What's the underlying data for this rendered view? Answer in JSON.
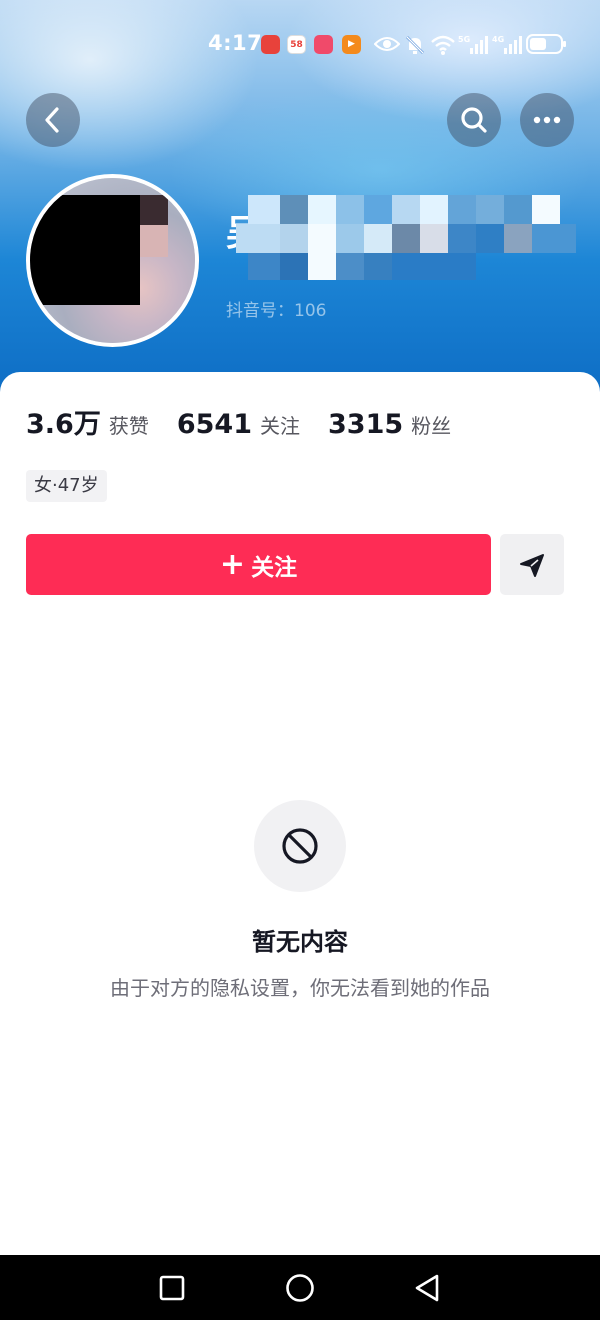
{
  "status_bar": {
    "time": "4:17",
    "app_badges": [
      {
        "name": "app-red",
        "text": "",
        "color": "#e8423b"
      },
      {
        "name": "app-58",
        "text": "58",
        "color": "#f3a21b"
      },
      {
        "name": "app-pink",
        "text": "",
        "color": "#f04a6a"
      },
      {
        "name": "app-play",
        "text": "",
        "color": "#f48a1c"
      }
    ],
    "network": "5G 4G",
    "battery_level": 0.55
  },
  "header": {
    "back_icon": "chevron-left-icon",
    "search_icon": "search-icon",
    "more_icon": "more-horizontal-icon",
    "nickname_partial": "吴",
    "id_label": "抖音号：106"
  },
  "stats": [
    {
      "num": "3.6万",
      "label": "获赞"
    },
    {
      "num": "6541",
      "label": "关注"
    },
    {
      "num": "3315",
      "label": "粉丝"
    }
  ],
  "profile_tag": "女·47岁",
  "actions": {
    "follow_plus": "+",
    "follow_label": "关注",
    "share_icon": "send-icon"
  },
  "empty_state": {
    "icon": "no-entry-icon",
    "title": "暂无内容",
    "description": "由于对方的隐私设置，你无法看到她的作品"
  },
  "nav": {
    "recent_icon": "square-icon",
    "home_icon": "circle-icon",
    "back_icon": "triangle-back-icon"
  },
  "colors": {
    "accent": "#fe2c55",
    "header_blue": "#1d86d6",
    "text_primary": "#161823"
  }
}
